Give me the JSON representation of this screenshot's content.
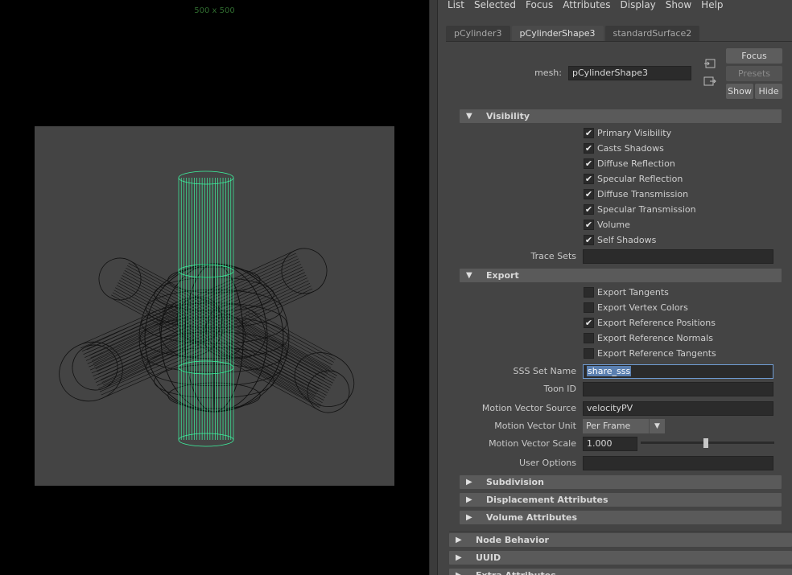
{
  "viewport": {
    "resolution_label": "500 x 500",
    "wire_color": "#3df5a0"
  },
  "menu": [
    "List",
    "Selected",
    "Focus",
    "Attributes",
    "Display",
    "Show",
    "Help"
  ],
  "tabs": [
    {
      "label": "pCylinder3",
      "active": false
    },
    {
      "label": "pCylinderShape3",
      "active": true
    },
    {
      "label": "standardSurface2",
      "active": false
    }
  ],
  "node": {
    "mesh_label": "mesh:",
    "mesh_value": "pCylinderShape3",
    "focus_button": "Focus",
    "presets_button": "Presets",
    "show_button": "Show",
    "hide_button": "Hide"
  },
  "visibility": {
    "title": "Visibility",
    "items": [
      {
        "label": "Primary Visibility",
        "checked": true
      },
      {
        "label": "Casts Shadows",
        "checked": true
      },
      {
        "label": "Diffuse Reflection",
        "checked": true
      },
      {
        "label": "Specular Reflection",
        "checked": true
      },
      {
        "label": "Diffuse Transmission",
        "checked": true
      },
      {
        "label": "Specular Transmission",
        "checked": true
      },
      {
        "label": "Volume",
        "checked": true
      },
      {
        "label": "Self Shadows",
        "checked": true
      }
    ],
    "trace_sets_label": "Trace Sets",
    "trace_sets_value": ""
  },
  "export": {
    "title": "Export",
    "items": [
      {
        "label": "Export Tangents",
        "checked": false
      },
      {
        "label": "Export Vertex Colors",
        "checked": false
      },
      {
        "label": "Export Reference Positions",
        "checked": true
      },
      {
        "label": "Export Reference Normals",
        "checked": false
      },
      {
        "label": "Export Reference Tangents",
        "checked": false
      }
    ],
    "sss_set_name_label": "SSS Set Name",
    "sss_set_name_value": "share_sss",
    "toon_id_label": "Toon ID",
    "toon_id_value": "",
    "motion_vector_source_label": "Motion Vector Source",
    "motion_vector_source_value": "velocityPV",
    "motion_vector_unit_label": "Motion Vector Unit",
    "motion_vector_unit_value": "Per Frame",
    "motion_vector_scale_label": "Motion Vector Scale",
    "motion_vector_scale_value": "1.000",
    "motion_vector_scale_slider": 0.49,
    "user_options_label": "User Options",
    "user_options_value": ""
  },
  "collapsed_sections": [
    "Subdivision",
    "Displacement Attributes",
    "Volume Attributes"
  ],
  "outer_sections": [
    "Node Behavior",
    "UUID",
    "Extra Attributes"
  ]
}
